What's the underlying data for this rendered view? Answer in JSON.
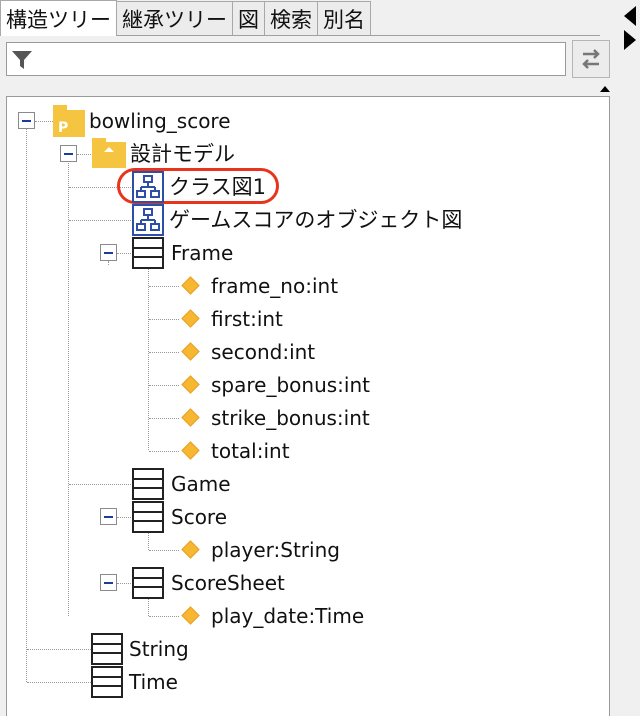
{
  "tabs": [
    {
      "label": "構造ツリー",
      "active": true
    },
    {
      "label": "継承ツリー",
      "active": false
    },
    {
      "label": "図",
      "active": false
    },
    {
      "label": "検索",
      "active": false
    },
    {
      "label": "別名",
      "active": false
    }
  ],
  "filter": {
    "value": "",
    "placeholder": ""
  },
  "icons": {
    "filter": "filter-icon",
    "sync": "sync-arrows-icon",
    "package": "package-icon",
    "model_folder": "model-folder-icon",
    "diagram": "class-diagram-icon",
    "class": "class-icon",
    "attribute": "attribute-icon"
  },
  "colors": {
    "highlight_ring": "#e8341c",
    "package": "#f5c542",
    "attribute": "#f7b733",
    "diagram_border": "#2d4fa8",
    "expander_minus": "#1a3c9b"
  },
  "tree": {
    "package": "bowling_score",
    "model": "設計モデル",
    "diagrams": [
      "クラス図1",
      "ゲームスコアのオブジェクト図"
    ],
    "selected_diagram": "クラス図1",
    "frame": {
      "name": "Frame",
      "attributes": [
        "frame_no:int",
        "first:int",
        "second:int",
        "spare_bonus:int",
        "strike_bonus:int",
        "total:int"
      ]
    },
    "game": {
      "name": "Game"
    },
    "score": {
      "name": "Score",
      "attributes": [
        "player:String"
      ]
    },
    "scoresheet": {
      "name": "ScoreSheet",
      "attributes": [
        "play_date:Time"
      ]
    },
    "string_class": {
      "name": "String"
    },
    "time_class": {
      "name": "Time"
    }
  }
}
